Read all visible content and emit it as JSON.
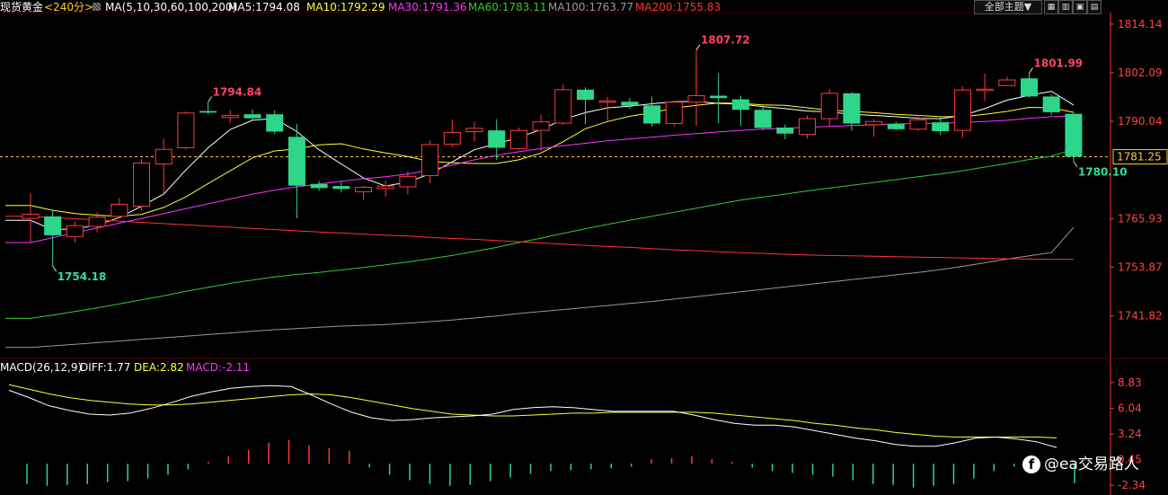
{
  "header": {
    "symbol": "现货黄金",
    "period": "<240分>",
    "ma_label": "MA(5,10,30,60,100,200)",
    "ma_values": [
      {
        "text": "MA5:1794.08",
        "color": "#ffffff"
      },
      {
        "text": "MA10:1792.29",
        "color": "#ffff33"
      },
      {
        "text": "MA30:1791.36",
        "color": "#ff33ff"
      },
      {
        "text": "MA60:1783.11",
        "color": "#33cc33"
      },
      {
        "text": "MA100:1763.77",
        "color": "#999999"
      },
      {
        "text": "MA200:1755.83",
        "color": "#ff3333"
      }
    ],
    "theme_button": "全部主题▼"
  },
  "macd_header": {
    "label": "MACD(26,12,9)",
    "diff": "DIFF:1.77",
    "dea": "DEA:2.82",
    "macd": "MACD:-2.11"
  },
  "watermark": "@ea交易路人",
  "colors": {
    "up": "#ff3b3b",
    "down": "#2ed68a",
    "grid": "#2a0000",
    "axis": "#ff3b3b"
  },
  "chart_data": [
    {
      "type": "candlestick",
      "title": "现货黄金 <240分>",
      "y_axis_ticks": [
        1814.14,
        1802.09,
        1790.04,
        1765.93,
        1753.87,
        1741.82
      ],
      "ylim": [
        1731.5,
        1817
      ],
      "current_price": 1781.25,
      "annotations": [
        {
          "index": 1,
          "price": 1754.18,
          "text": "1754.18",
          "anchor": "low"
        },
        {
          "index": 8,
          "price": 1794.84,
          "text": "1794.84",
          "anchor": "high"
        },
        {
          "index": 30,
          "price": 1807.72,
          "text": "1807.72",
          "anchor": "high"
        },
        {
          "index": 45,
          "price": 1801.99,
          "text": "1801.99",
          "anchor": "high"
        },
        {
          "index": 47,
          "price": 1780.1,
          "text": "1780.10",
          "anchor": "low"
        }
      ],
      "candles": [
        {
          "o": 1766.0,
          "h": 1772.2,
          "l": 1760.0,
          "c": 1767.0
        },
        {
          "o": 1766.5,
          "h": 1768.0,
          "l": 1754.18,
          "c": 1761.8
        },
        {
          "o": 1761.5,
          "h": 1765.2,
          "l": 1760.0,
          "c": 1764.2
        },
        {
          "o": 1764.0,
          "h": 1767.5,
          "l": 1762.5,
          "c": 1766.3
        },
        {
          "o": 1766.5,
          "h": 1771.0,
          "l": 1766.0,
          "c": 1769.5
        },
        {
          "o": 1769.0,
          "h": 1780.7,
          "l": 1768.0,
          "c": 1779.7
        },
        {
          "o": 1779.5,
          "h": 1785.8,
          "l": 1772.0,
          "c": 1783.1
        },
        {
          "o": 1783.5,
          "h": 1792.5,
          "l": 1783.0,
          "c": 1792.1
        },
        {
          "o": 1792.6,
          "h": 1794.84,
          "l": 1791.8,
          "c": 1792.2
        },
        {
          "o": 1791.0,
          "h": 1792.8,
          "l": 1789.7,
          "c": 1791.5
        },
        {
          "o": 1791.8,
          "h": 1793.0,
          "l": 1790.3,
          "c": 1790.8
        },
        {
          "o": 1791.8,
          "h": 1792.8,
          "l": 1786.8,
          "c": 1787.5
        },
        {
          "o": 1786.2,
          "h": 1789.4,
          "l": 1766.0,
          "c": 1774.1
        },
        {
          "o": 1774.5,
          "h": 1775.3,
          "l": 1772.8,
          "c": 1773.5
        },
        {
          "o": 1774.0,
          "h": 1775.2,
          "l": 1772.4,
          "c": 1773.3
        },
        {
          "o": 1772.6,
          "h": 1774.0,
          "l": 1770.6,
          "c": 1773.7
        },
        {
          "o": 1773.4,
          "h": 1775.3,
          "l": 1771.4,
          "c": 1774.0
        },
        {
          "o": 1773.8,
          "h": 1777.7,
          "l": 1771.9,
          "c": 1776.4
        },
        {
          "o": 1776.6,
          "h": 1785.3,
          "l": 1774.7,
          "c": 1784.3
        },
        {
          "o": 1784.4,
          "h": 1790.5,
          "l": 1783.6,
          "c": 1787.3
        },
        {
          "o": 1787.5,
          "h": 1790.0,
          "l": 1785.0,
          "c": 1788.3
        },
        {
          "o": 1787.8,
          "h": 1790.6,
          "l": 1780.5,
          "c": 1783.5
        },
        {
          "o": 1783.3,
          "h": 1788.5,
          "l": 1782.9,
          "c": 1787.8
        },
        {
          "o": 1787.8,
          "h": 1791.7,
          "l": 1782.7,
          "c": 1789.9
        },
        {
          "o": 1789.6,
          "h": 1799.2,
          "l": 1789.2,
          "c": 1797.9
        },
        {
          "o": 1797.9,
          "h": 1798.5,
          "l": 1789.3,
          "c": 1795.4
        },
        {
          "o": 1794.9,
          "h": 1796.1,
          "l": 1790.2,
          "c": 1795.1
        },
        {
          "o": 1794.9,
          "h": 1795.9,
          "l": 1793.2,
          "c": 1793.9
        },
        {
          "o": 1794.0,
          "h": 1796.2,
          "l": 1788.7,
          "c": 1789.5
        },
        {
          "o": 1789.5,
          "h": 1795.2,
          "l": 1788.8,
          "c": 1794.8
        },
        {
          "o": 1794.8,
          "h": 1807.72,
          "l": 1788.9,
          "c": 1796.4
        },
        {
          "o": 1796.4,
          "h": 1802.0,
          "l": 1789.6,
          "c": 1795.8
        },
        {
          "o": 1795.5,
          "h": 1796.4,
          "l": 1788.9,
          "c": 1792.9
        },
        {
          "o": 1792.9,
          "h": 1794.0,
          "l": 1787.9,
          "c": 1788.4
        },
        {
          "o": 1788.5,
          "h": 1789.3,
          "l": 1785.6,
          "c": 1787.0
        },
        {
          "o": 1786.8,
          "h": 1791.5,
          "l": 1785.8,
          "c": 1790.7
        },
        {
          "o": 1790.7,
          "h": 1798.1,
          "l": 1788.8,
          "c": 1797.0
        },
        {
          "o": 1797.0,
          "h": 1797.3,
          "l": 1787.7,
          "c": 1789.5
        },
        {
          "o": 1789.2,
          "h": 1790.6,
          "l": 1786.2,
          "c": 1790.0
        },
        {
          "o": 1789.4,
          "h": 1789.9,
          "l": 1787.8,
          "c": 1788.1
        },
        {
          "o": 1788.1,
          "h": 1791.6,
          "l": 1787.6,
          "c": 1790.4
        },
        {
          "o": 1789.8,
          "h": 1791.3,
          "l": 1786.6,
          "c": 1787.6
        },
        {
          "o": 1787.8,
          "h": 1798.7,
          "l": 1786.0,
          "c": 1797.8
        },
        {
          "o": 1797.8,
          "h": 1801.9,
          "l": 1795.1,
          "c": 1798.0
        },
        {
          "o": 1798.9,
          "h": 1801.1,
          "l": 1798.7,
          "c": 1800.3
        },
        {
          "o": 1800.7,
          "h": 1801.99,
          "l": 1795.9,
          "c": 1796.2
        },
        {
          "o": 1796.2,
          "h": 1796.7,
          "l": 1791.6,
          "c": 1792.3
        },
        {
          "o": 1791.9,
          "h": 1792.2,
          "l": 1780.1,
          "c": 1781.3
        }
      ],
      "moving_averages": [
        {
          "name": "MA5",
          "color": "#ffffff",
          "values": [
            1765.5,
            1763.2,
            1763.4,
            1764.3,
            1766.2,
            1769.0,
            1772.0,
            1778.0,
            1783.5,
            1788.0,
            1790.3,
            1790.8,
            1787.5,
            1783.0,
            1779.5,
            1776.0,
            1774.0,
            1775.0,
            1777.0,
            1780.0,
            1783.0,
            1784.5,
            1786.0,
            1788.0,
            1790.5,
            1792.2,
            1793.4,
            1793.8,
            1794.4,
            1794.9,
            1795.0,
            1794.5,
            1794.3,
            1793.7,
            1793.2,
            1792.6,
            1792.4,
            1791.8,
            1791.5,
            1791.2,
            1790.8,
            1790.7,
            1791.5,
            1793.2,
            1795.3,
            1796.5,
            1797.5,
            1794.08
          ]
        },
        {
          "name": "MA10",
          "color": "#ffff33",
          "values": [
            1769.2,
            1768.0,
            1767.2,
            1766.8,
            1766.5,
            1767.0,
            1768.7,
            1771.3,
            1774.6,
            1777.8,
            1781.0,
            1782.7,
            1783.2,
            1784.2,
            1784.5,
            1783.2,
            1782.2,
            1781.3,
            1780.1,
            1779.8,
            1779.6,
            1779.6,
            1780.5,
            1782.2,
            1785.0,
            1788.2,
            1790.0,
            1791.3,
            1792.2,
            1793.3,
            1794.0,
            1794.6,
            1794.5,
            1794.1,
            1794.0,
            1793.4,
            1792.8,
            1792.5,
            1792.2,
            1791.8,
            1791.5,
            1791.2,
            1791.2,
            1791.8,
            1792.5,
            1793.5,
            1793.4,
            1792.29
          ]
        },
        {
          "name": "MA30",
          "color": "#ff33ff",
          "values": [
            1760.0,
            1761.2,
            1762.4,
            1763.6,
            1764.8,
            1766.0,
            1767.2,
            1768.4,
            1769.6,
            1770.8,
            1772.0,
            1773.0,
            1773.8,
            1774.5,
            1775.2,
            1775.8,
            1776.3,
            1777.0,
            1778.0,
            1779.2,
            1780.5,
            1781.6,
            1782.5,
            1783.3,
            1784.0,
            1784.6,
            1785.2,
            1785.7,
            1786.1,
            1786.6,
            1787.0,
            1787.4,
            1787.8,
            1788.1,
            1788.3,
            1788.6,
            1788.8,
            1789.0,
            1789.2,
            1789.4,
            1789.5,
            1789.6,
            1789.8,
            1790.0,
            1790.3,
            1790.8,
            1791.2,
            1791.36
          ]
        },
        {
          "name": "MA60",
          "color": "#33cc33",
          "values": [
            1741.2,
            1742.0,
            1742.9,
            1743.8,
            1744.8,
            1745.8,
            1746.8,
            1747.9,
            1748.9,
            1749.9,
            1750.7,
            1751.5,
            1752.1,
            1752.6,
            1753.2,
            1753.8,
            1754.5,
            1755.2,
            1756.0,
            1756.8,
            1757.8,
            1758.8,
            1760.0,
            1761.1,
            1762.3,
            1763.4,
            1764.5,
            1765.5,
            1766.5,
            1767.5,
            1768.5,
            1769.5,
            1770.5,
            1771.3,
            1772.0,
            1772.8,
            1773.5,
            1774.2,
            1774.9,
            1775.6,
            1776.3,
            1777.0,
            1777.8,
            1778.7,
            1779.6,
            1780.6,
            1781.4,
            1783.11
          ]
        },
        {
          "name": "MA100",
          "color": "#999999",
          "values": [
            1734.0,
            1734.4,
            1734.8,
            1735.2,
            1735.6,
            1736.0,
            1736.4,
            1736.8,
            1737.2,
            1737.6,
            1738.0,
            1738.4,
            1738.7,
            1739.0,
            1739.3,
            1739.5,
            1739.7,
            1740.0,
            1740.4,
            1740.8,
            1741.3,
            1741.8,
            1742.4,
            1742.9,
            1743.4,
            1743.9,
            1744.4,
            1744.9,
            1745.4,
            1746.0,
            1746.6,
            1747.2,
            1747.8,
            1748.4,
            1749.0,
            1749.6,
            1750.2,
            1750.8,
            1751.4,
            1752.0,
            1752.6,
            1753.3,
            1754.1,
            1755.0,
            1755.9,
            1756.7,
            1757.5,
            1763.77
          ]
        },
        {
          "name": "MA200",
          "color": "#ff3333",
          "values": [
            1766.5,
            1766.2,
            1765.9,
            1765.6,
            1765.3,
            1765.0,
            1764.7,
            1764.4,
            1764.1,
            1763.8,
            1763.5,
            1763.2,
            1762.9,
            1762.6,
            1762.4,
            1762.1,
            1761.8,
            1761.6,
            1761.3,
            1761.0,
            1760.8,
            1760.5,
            1760.2,
            1759.9,
            1759.6,
            1759.3,
            1759.0,
            1758.8,
            1758.5,
            1758.2,
            1758.0,
            1757.7,
            1757.5,
            1757.3,
            1757.1,
            1756.9,
            1756.8,
            1756.7,
            1756.6,
            1756.5,
            1756.4,
            1756.3,
            1756.2,
            1756.1,
            1756.0,
            1755.9,
            1755.85,
            1755.83
          ]
        }
      ]
    },
    {
      "type": "macd",
      "title": "MACD(26,12,9)",
      "y_axis_ticks": [
        8.83,
        6.04,
        3.24,
        0.45,
        -2.34
      ],
      "ylim": [
        -3.4,
        9.6
      ],
      "diff": [
        8.0,
        7.2,
        6.3,
        5.8,
        5.4,
        5.3,
        5.5,
        6.0,
        6.6,
        7.3,
        7.8,
        8.2,
        8.4,
        8.5,
        8.4,
        7.5,
        6.5,
        5.6,
        5.0,
        4.7,
        4.8,
        5.0,
        5.1,
        5.2,
        5.4,
        5.9,
        6.1,
        6.2,
        6.1,
        5.9,
        5.7,
        5.7,
        5.7,
        5.7,
        5.3,
        4.8,
        4.4,
        4.2,
        4.2,
        4.0,
        3.6,
        3.2,
        2.8,
        2.5,
        2.1,
        1.9,
        1.9,
        2.3,
        2.8,
        2.9,
        2.7,
        2.4,
        1.77
      ],
      "dea": [
        8.6,
        8.1,
        7.6,
        7.2,
        6.9,
        6.7,
        6.5,
        6.4,
        6.4,
        6.5,
        6.7,
        6.9,
        7.1,
        7.3,
        7.5,
        7.6,
        7.5,
        7.2,
        6.8,
        6.4,
        6.0,
        5.7,
        5.4,
        5.3,
        5.2,
        5.2,
        5.3,
        5.4,
        5.5,
        5.5,
        5.6,
        5.6,
        5.6,
        5.6,
        5.6,
        5.5,
        5.3,
        5.1,
        4.9,
        4.7,
        4.4,
        4.2,
        3.9,
        3.7,
        3.4,
        3.2,
        3.0,
        2.9,
        2.9,
        2.9,
        2.9,
        2.9,
        2.82
      ],
      "histogram": [
        -2.2,
        -2.4,
        -2.3,
        -2.2,
        -2.0,
        -1.9,
        -1.6,
        -1.2,
        -0.6,
        0.2,
        0.8,
        1.5,
        2.3,
        2.6,
        2.0,
        1.7,
        1.4,
        -0.4,
        -1.2,
        -1.8,
        -2.2,
        -2.4,
        -2.3,
        -1.9,
        -1.5,
        -1.1,
        -0.8,
        -0.7,
        -0.6,
        -0.5,
        -0.3,
        0.5,
        0.6,
        0.8,
        0.5,
        0.2,
        -0.4,
        -0.8,
        -1.0,
        -1.2,
        -1.4,
        -1.8,
        -2.2,
        -2.3,
        -2.6,
        -2.4,
        -2.2,
        -1.6,
        -0.8,
        -0.3,
        0.1,
        0.0,
        -2.11
      ]
    }
  ]
}
